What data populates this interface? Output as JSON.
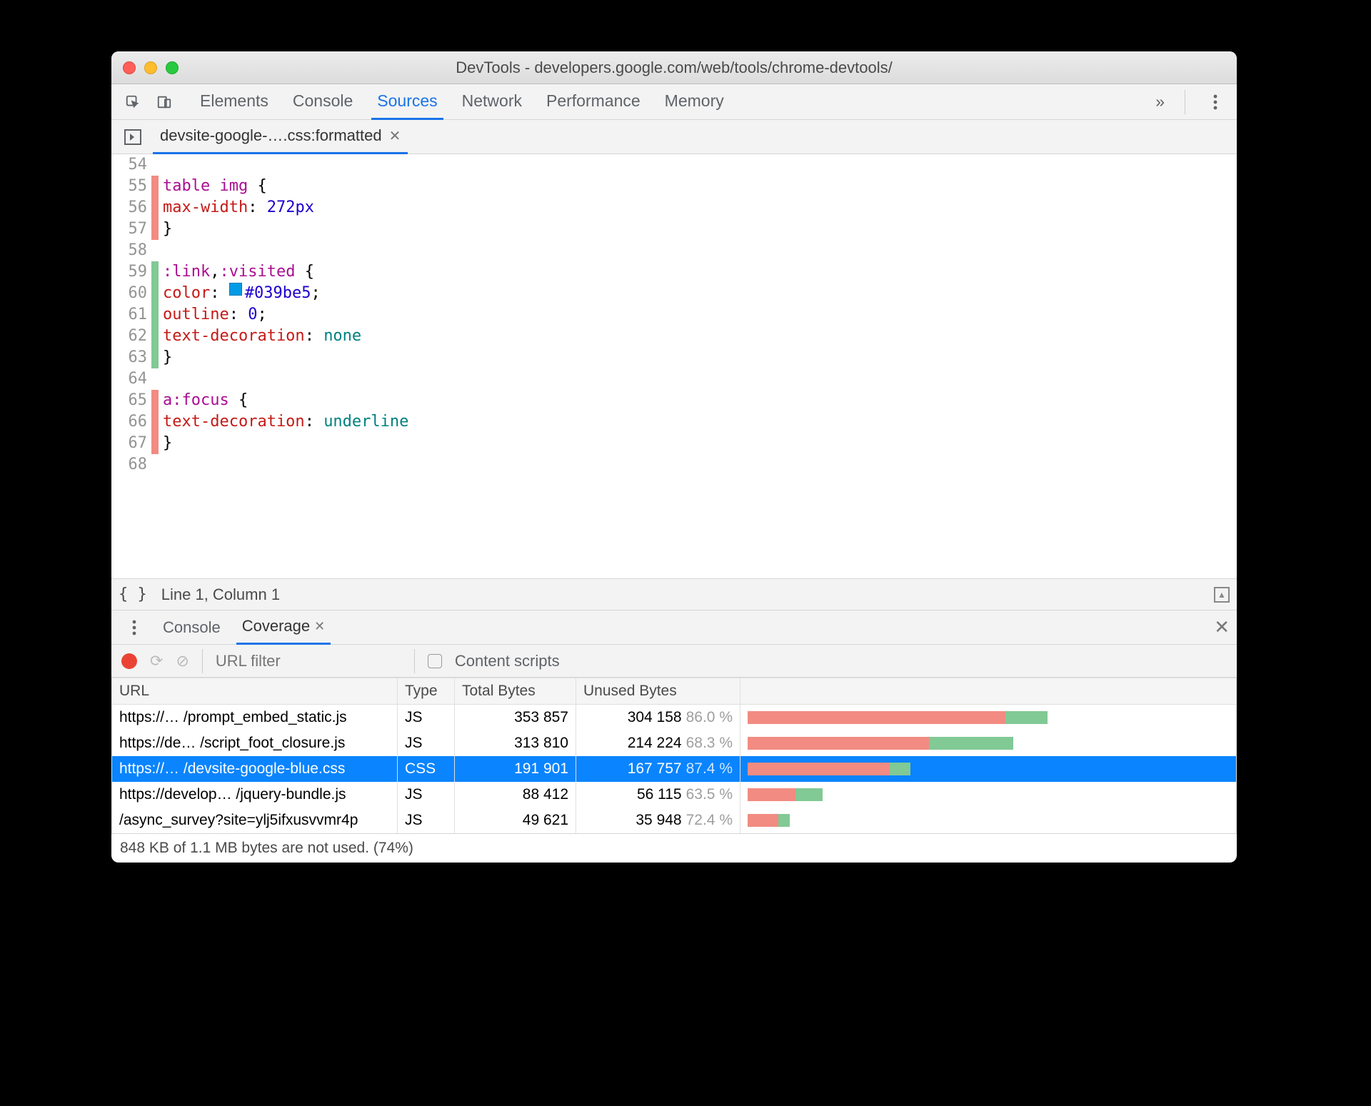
{
  "window": {
    "title": "DevTools - developers.google.com/web/tools/chrome-devtools/"
  },
  "tabs": {
    "items": [
      "Elements",
      "Console",
      "Sources",
      "Network",
      "Performance",
      "Memory"
    ],
    "active": 2,
    "more": "»"
  },
  "file_tab": {
    "name": "devsite-google-….css:formatted"
  },
  "status": {
    "format_btn": "{ }",
    "cursor": "Line 1, Column 1"
  },
  "code_lines": [
    {
      "n": 54,
      "cov": "",
      "html": ""
    },
    {
      "n": 55,
      "cov": "red",
      "html": "<span class='tok-sel'>table img</span> {"
    },
    {
      "n": 56,
      "cov": "red",
      "html": "  <span class='tok-prop'>max-width</span>: <span class='tok-val'>272px</span>"
    },
    {
      "n": 57,
      "cov": "red",
      "html": "}"
    },
    {
      "n": 58,
      "cov": "",
      "html": ""
    },
    {
      "n": 59,
      "cov": "green",
      "html": "<span class='tok-sel'>:link</span>,<span class='tok-sel'>:visited</span> {"
    },
    {
      "n": 60,
      "cov": "green",
      "html": "  <span class='tok-prop'>color</span>: <span class='swatch'></span><span class='tok-val'>#039be5</span>;"
    },
    {
      "n": 61,
      "cov": "green",
      "html": "  <span class='tok-prop'>outline</span>: <span class='tok-val'>0</span>;"
    },
    {
      "n": 62,
      "cov": "green",
      "html": "  <span class='tok-prop'>text-decoration</span>: <span class='tok-kw'>none</span>"
    },
    {
      "n": 63,
      "cov": "green",
      "html": "}"
    },
    {
      "n": 64,
      "cov": "",
      "html": ""
    },
    {
      "n": 65,
      "cov": "red",
      "html": "<span class='tok-sel'>a:focus</span> {"
    },
    {
      "n": 66,
      "cov": "red",
      "html": "  <span class='tok-prop'>text-decoration</span>: <span class='tok-kw'>underline</span>"
    },
    {
      "n": 67,
      "cov": "red",
      "html": "}"
    },
    {
      "n": 68,
      "cov": "",
      "html": ""
    }
  ],
  "drawer": {
    "tabs": {
      "items": [
        "Console",
        "Coverage"
      ],
      "active": 1
    },
    "toolbar": {
      "filter_placeholder": "URL filter",
      "content_scripts_label": "Content scripts"
    }
  },
  "coverage": {
    "headers": {
      "url": "URL",
      "type": "Type",
      "total": "Total Bytes",
      "unused": "Unused Bytes"
    },
    "max_total": 353857,
    "rows": [
      {
        "url": "https://… /prompt_embed_static.js",
        "type": "JS",
        "total": "353 857",
        "unused": "304 158",
        "pct": "86.0 %",
        "total_n": 353857,
        "unused_pct": 86.0,
        "selected": false
      },
      {
        "url": "https://de… /script_foot_closure.js",
        "type": "JS",
        "total": "313 810",
        "unused": "214 224",
        "pct": "68.3 %",
        "total_n": 313810,
        "unused_pct": 68.3,
        "selected": false
      },
      {
        "url": "https://… /devsite-google-blue.css",
        "type": "CSS",
        "total": "191 901",
        "unused": "167 757",
        "pct": "87.4 %",
        "total_n": 191901,
        "unused_pct": 87.4,
        "selected": true
      },
      {
        "url": "https://develop… /jquery-bundle.js",
        "type": "JS",
        "total": "88 412",
        "unused": "56 115",
        "pct": "63.5 %",
        "total_n": 88412,
        "unused_pct": 63.5,
        "selected": false
      },
      {
        "url": "/async_survey?site=ylj5ifxusvvmr4p",
        "type": "JS",
        "total": "49 621",
        "unused": "35 948",
        "pct": "72.4 %",
        "total_n": 49621,
        "unused_pct": 72.4,
        "selected": false
      }
    ],
    "summary": "848 KB of 1.1 MB bytes are not used. (74%)"
  },
  "colors": {
    "unused_bar": "#f28b82",
    "used_bar": "#81c995",
    "accent": "#1a73e8",
    "selection": "#0a84ff"
  }
}
